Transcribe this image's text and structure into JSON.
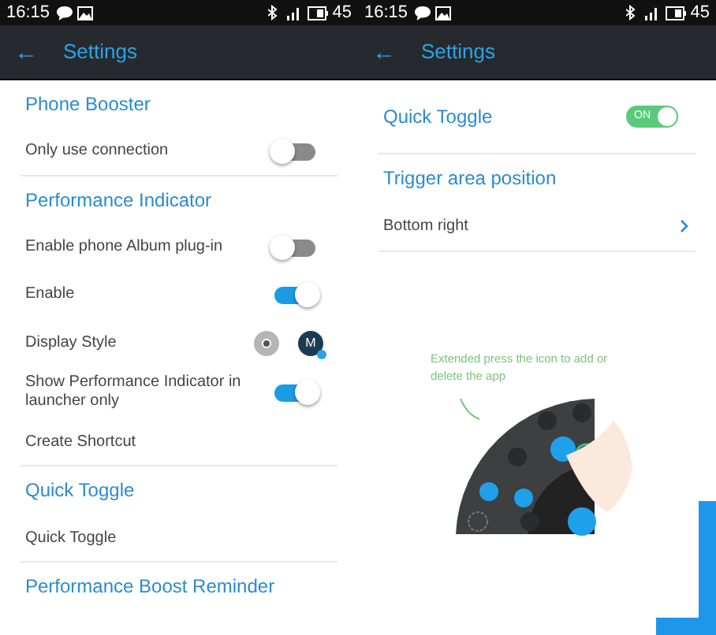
{
  "screens": [
    {
      "status_bar": {
        "time": "16:15",
        "battery": "45"
      },
      "app_bar": {
        "back": "←",
        "title": "Settings"
      },
      "items": [
        {
          "kind": "header",
          "label": "Phone Booster"
        },
        {
          "kind": "toggle",
          "label": "Only use connection",
          "on": false
        },
        {
          "kind": "divider"
        },
        {
          "kind": "header",
          "label": "Performance Indicator"
        },
        {
          "kind": "toggle",
          "label": "Enable phone Album plug-in",
          "on": false
        },
        {
          "kind": "toggle",
          "label": "Enable",
          "on": true
        },
        {
          "kind": "style",
          "label": "Display Style",
          "options": [
            {
              "selected": false
            },
            {
              "letter": "M",
              "selected": true
            }
          ]
        },
        {
          "kind": "toggle",
          "label": "Show Performance Indicator in launcher only",
          "on": true
        },
        {
          "kind": "text",
          "label": "Create Shortcut"
        },
        {
          "kind": "divider"
        },
        {
          "kind": "header",
          "label": "Quick Toggle"
        },
        {
          "kind": "text",
          "label": "Quick Toggle"
        },
        {
          "kind": "divider"
        },
        {
          "kind": "header",
          "label": "Performance Boost Reminder"
        }
      ]
    },
    {
      "status_bar": {
        "time": "16:15",
        "battery": "45"
      },
      "app_bar": {
        "back": "←",
        "title": "Settings"
      },
      "items": [
        {
          "kind": "main_toggle",
          "label": "Quick Toggle",
          "on": true,
          "on_text": "ON"
        },
        {
          "kind": "divider"
        },
        {
          "kind": "header",
          "label": "Trigger area position"
        },
        {
          "kind": "link",
          "label": "Bottom right"
        },
        {
          "kind": "divider"
        },
        {
          "kind": "illustration",
          "caption": "Extended press the icon to add or delete the app"
        }
      ]
    }
  ]
}
